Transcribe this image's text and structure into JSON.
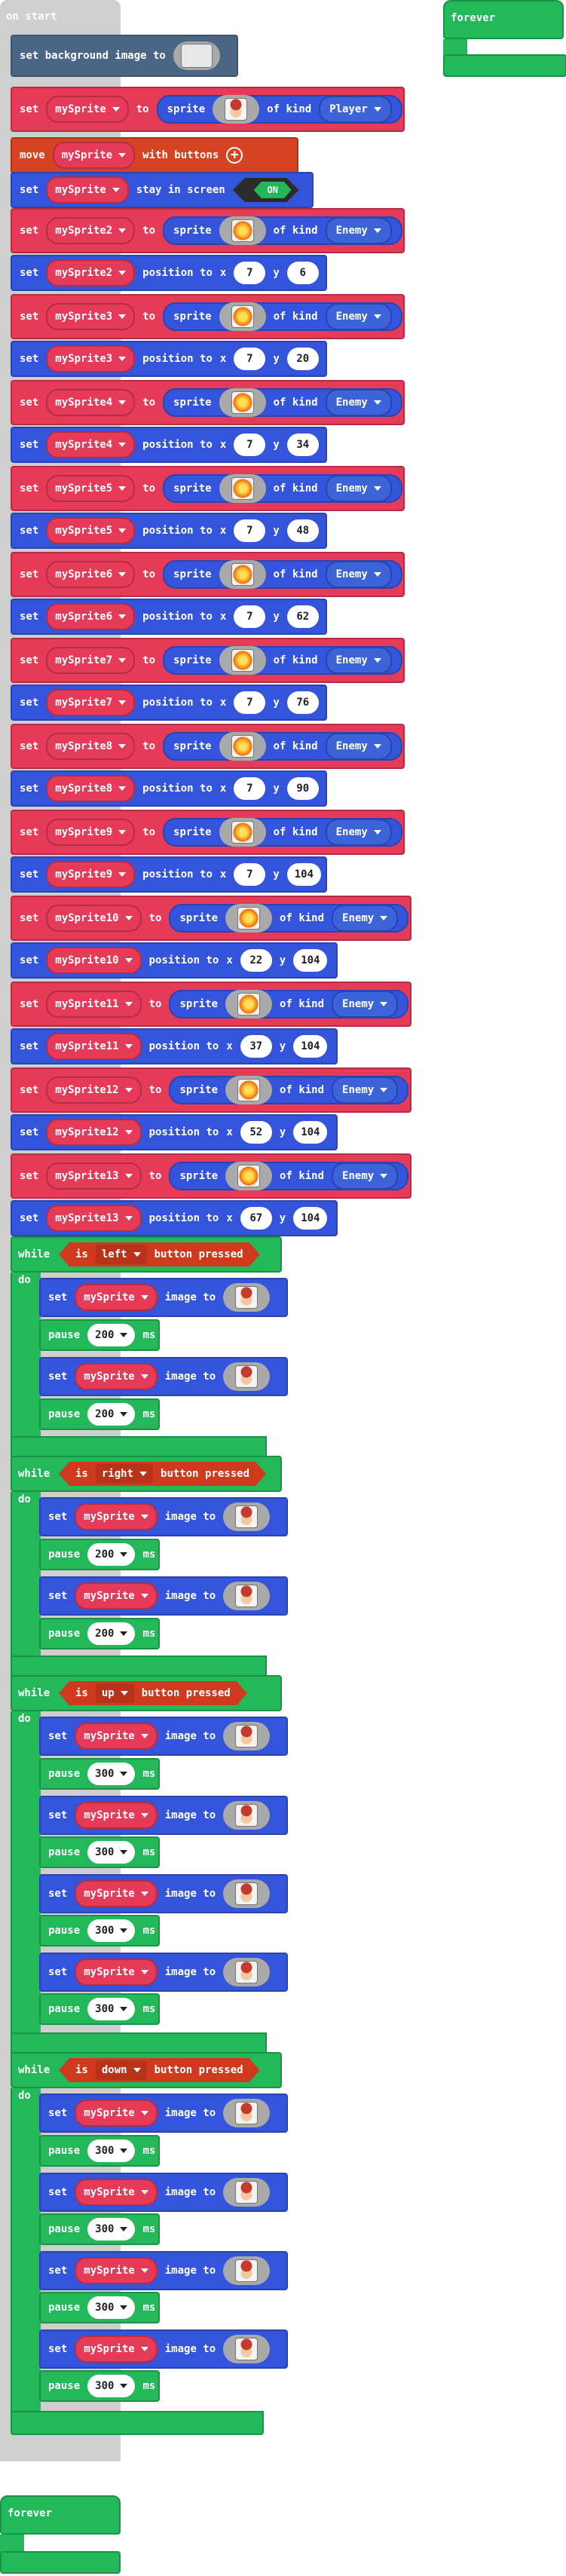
{
  "on_start": {
    "label": "on start",
    "set_background": {
      "text": "set background image to",
      "image_icon": "background-image-thumbnail"
    },
    "player": {
      "set": "set",
      "var": "mySprite",
      "to": "to",
      "sprite": "sprite",
      "of_kind": "of kind",
      "kind": "Player",
      "image_icon": "hero-sprite-thumbnail"
    },
    "move": {
      "move": "move",
      "var": "mySprite",
      "with_buttons": "with buttons"
    },
    "stay": {
      "set": "set",
      "var": "mySprite",
      "stay_in_screen": "stay in screen",
      "toggle": "ON"
    },
    "enemies": [
      {
        "var": "mySprite2",
        "x": "7",
        "y": "6"
      },
      {
        "var": "mySprite3",
        "x": "7",
        "y": "20"
      },
      {
        "var": "mySprite4",
        "x": "7",
        "y": "34"
      },
      {
        "var": "mySprite5",
        "x": "7",
        "y": "48"
      },
      {
        "var": "mySprite6",
        "x": "7",
        "y": "62"
      },
      {
        "var": "mySprite7",
        "x": "7",
        "y": "76"
      },
      {
        "var": "mySprite8",
        "x": "7",
        "y": "90"
      },
      {
        "var": "mySprite9",
        "x": "7",
        "y": "104"
      },
      {
        "var": "mySprite10",
        "x": "22",
        "y": "104"
      },
      {
        "var": "mySprite11",
        "x": "37",
        "y": "104"
      },
      {
        "var": "mySprite12",
        "x": "52",
        "y": "104"
      },
      {
        "var": "mySprite13",
        "x": "67",
        "y": "104"
      }
    ],
    "enemy_labels": {
      "set": "set",
      "to": "to",
      "sprite": "sprite",
      "of_kind": "of kind",
      "kind": "Enemy",
      "position_to": "position to",
      "x": "x",
      "y": "y",
      "image_icon": "explosion-sprite-thumbnail"
    },
    "loops": [
      {
        "direction": "left",
        "pause_ms": [
          "200",
          "200"
        ]
      },
      {
        "direction": "right",
        "pause_ms": [
          "200",
          "200"
        ]
      },
      {
        "direction": "up",
        "pause_ms": [
          "300",
          "300",
          "300",
          "300"
        ]
      },
      {
        "direction": "down",
        "pause_ms": [
          "300",
          "300",
          "300",
          "300"
        ]
      }
    ],
    "loop_labels": {
      "while": "while",
      "do": "do",
      "is": "is",
      "button_pressed": "button pressed",
      "set": "set",
      "var": "mySprite",
      "image_to": "image to",
      "pause": "pause",
      "ms": "ms"
    }
  },
  "forever_blocks": [
    "forever",
    "forever"
  ],
  "colors": {
    "scene": "#4b6584",
    "sprites": "#3455db",
    "sprite_var": "#e63b58",
    "controller": "#d54322",
    "loops": "#23b85a",
    "canvas": "#ffffff",
    "hat": "#cfcfcf"
  }
}
